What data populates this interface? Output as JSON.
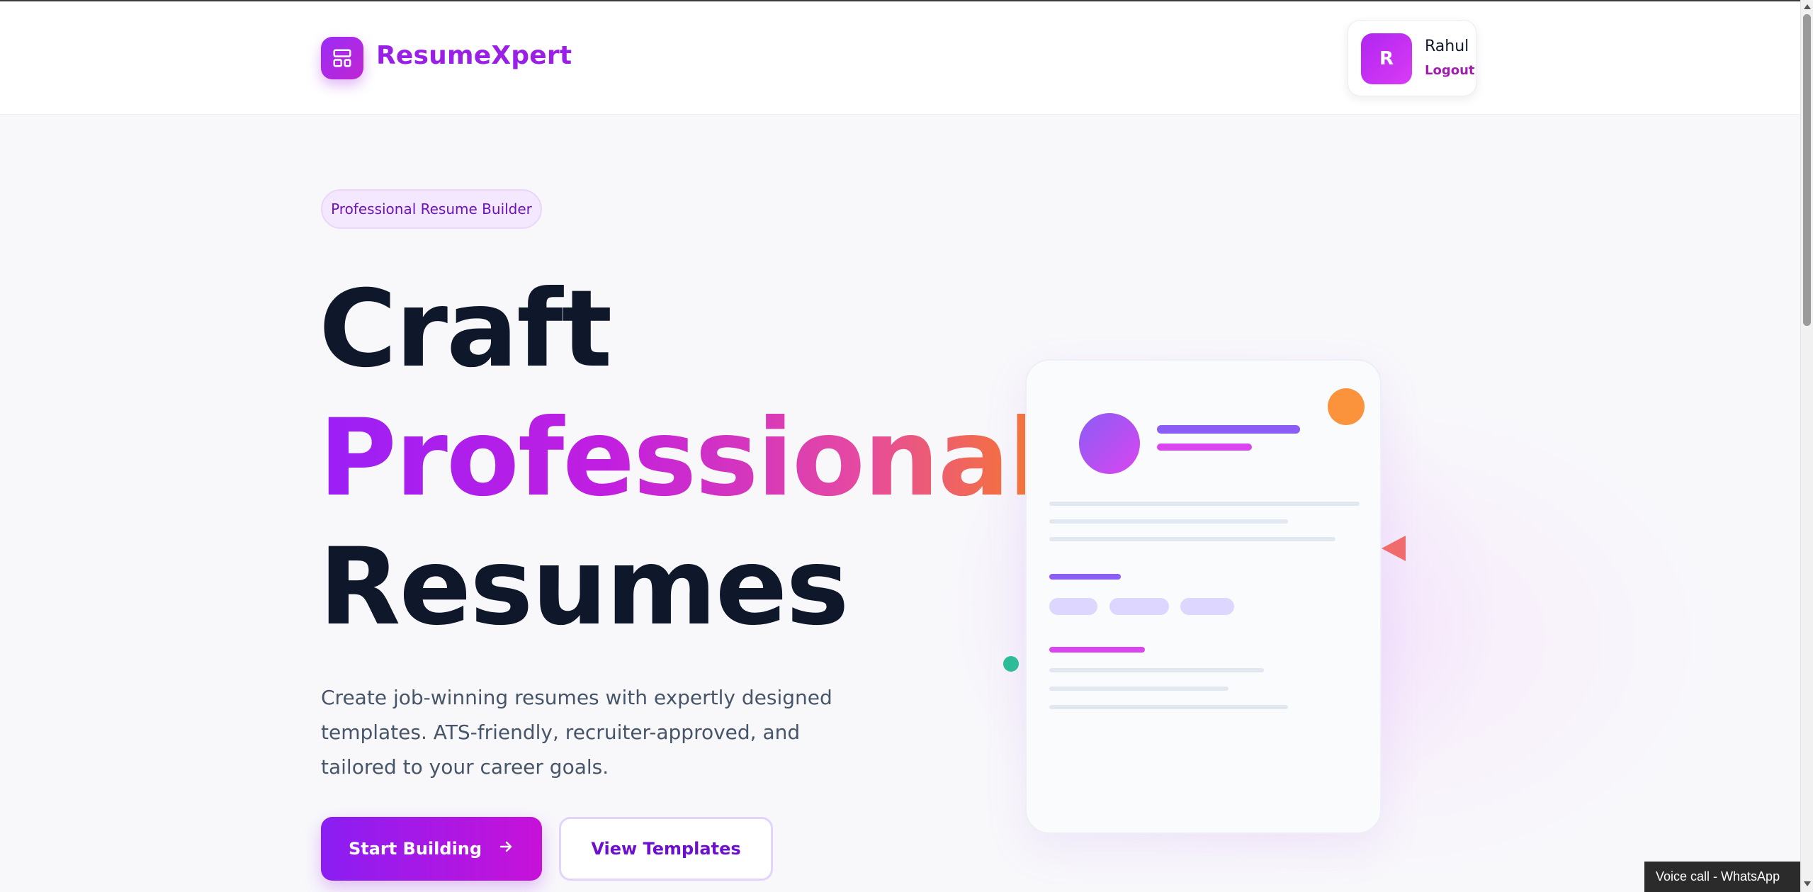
{
  "header": {
    "brand": "ResumeXpert",
    "logo_icon": "layout-template-icon"
  },
  "user": {
    "initial": "R",
    "name": "Rahul",
    "logout_label": "Logout"
  },
  "hero": {
    "badge": "Professional Resume Builder",
    "headline_line1": "Craft",
    "headline_line2": "Professional",
    "headline_line3": "Resumes",
    "description": "Create job-winning resumes with expertly designed templates. ATS-friendly, recruiter-approved, and tailored to your career goals.",
    "primary_button": "Start Building",
    "primary_button_icon": "arrow-right-icon",
    "secondary_button": "View Templates"
  },
  "illustration": {
    "accent_colors": [
      "#8b5cf6",
      "#d946ef",
      "#fb923c",
      "#f06b6b",
      "#2bbf95"
    ]
  },
  "system": {
    "taskbar_toast": "Voice call - WhatsApp"
  }
}
